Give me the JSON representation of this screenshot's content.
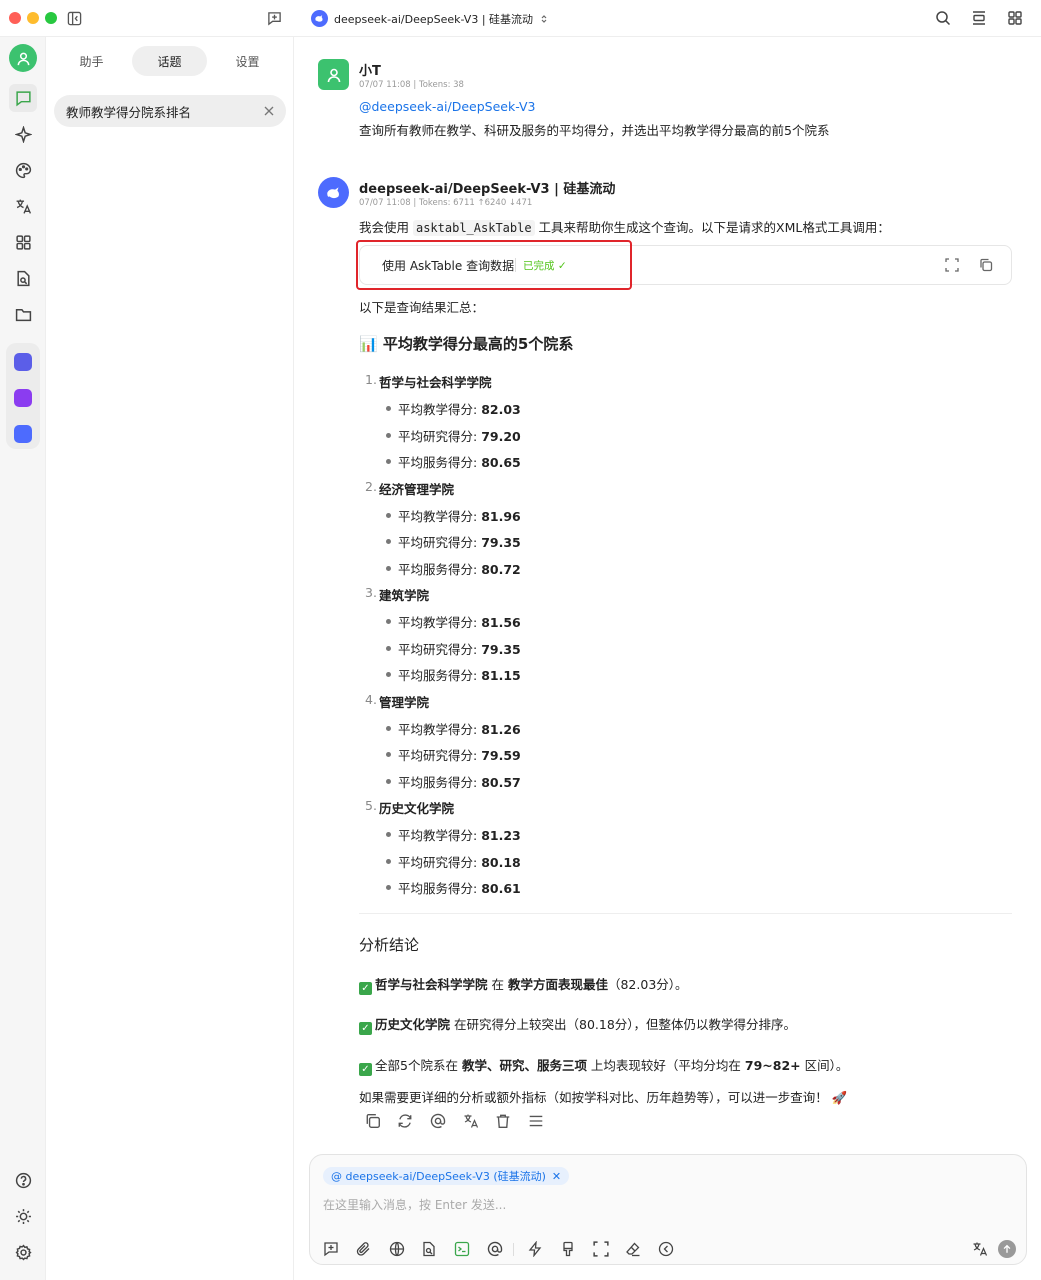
{
  "window": {
    "model_title": "deepseek-ai/DeepSeek-V3 | 硅基流动"
  },
  "sidebar": {
    "tabs": [
      "助手",
      "话题",
      "设置"
    ],
    "active_tab": "话题",
    "topic": "教师教学得分院系排名"
  },
  "messages": {
    "user": {
      "name": "小T",
      "meta": "07/07 11:08  |  Tokens: 38",
      "mention": "@deepseek-ai/DeepSeek-V3",
      "text": "查询所有教师在教学、科研及服务的平均得分，并选出平均教学得分最高的前5个院系"
    },
    "assistant": {
      "name": "deepseek-ai/DeepSeek-V3 | 硅基流动",
      "meta": "07/07 11:08  |  Tokens: 6711 ↑6240 ↓471",
      "intro_before": "我会使用 ",
      "intro_code": "asktabl_AskTable",
      "intro_after": " 工具来帮助你生成这个查询。以下是请求的XML格式工具调用：",
      "tool_label": "使用 AskTable 查询数据",
      "tool_status": "已完成 ✓",
      "summary_intro": "以下是查询结果汇总：",
      "heading": "📊 平均教学得分最高的5个院系",
      "label_teaching": "平均教学得分: ",
      "label_research": "平均研究得分: ",
      "label_service": "平均服务得分: ",
      "departments": [
        {
          "num": "1.",
          "name": "哲学与社会科学学院",
          "teaching": "82.03",
          "research": "79.20",
          "service": "80.65"
        },
        {
          "num": "2.",
          "name": "经济管理学院",
          "teaching": "81.96",
          "research": "79.35",
          "service": "80.72"
        },
        {
          "num": "3.",
          "name": "建筑学院",
          "teaching": "81.56",
          "research": "79.35",
          "service": "81.15"
        },
        {
          "num": "4.",
          "name": "管理学院",
          "teaching": "81.26",
          "research": "79.59",
          "service": "80.57"
        },
        {
          "num": "5.",
          "name": "历史文化学院",
          "teaching": "81.23",
          "research": "80.18",
          "service": "80.61"
        }
      ],
      "conclusion_title": "分析结论",
      "conclusions": [
        {
          "b1": "哲学与社会科学学院",
          "t1": " 在 ",
          "b2": "教学方面表现最佳",
          "t2": "（82.03分）。",
          "b3": "",
          "t3": ""
        },
        {
          "b1": "历史文化学院",
          "t1": " 在研究得分上较突出（80.18分），但整体仍以教学得分排序。",
          "b2": "",
          "t2": "",
          "b3": "",
          "t3": ""
        },
        {
          "b1": "",
          "t1": "全部5个院系在 ",
          "b2": "教学、研究、服务三项",
          "t2": " 上均表现较好（平均分均在 ",
          "b3": "79~82+",
          "t3": " 区间）。"
        }
      ],
      "closing": "如果需要更详细的分析或额外指标（如按学科对比、历年趋势等），可以进一步查询！ 🚀"
    }
  },
  "composer": {
    "chip": "@ deepseek-ai/DeepSeek-V3 (硅基流动)",
    "placeholder": "在这里输入消息，按 Enter 发送..."
  },
  "colors": {
    "accent": "#1a73e8",
    "user_avatar": "#3cc26f",
    "assistant_avatar": "#4d6bfe",
    "highlight_box": "#e0252b",
    "check_green": "#3aa64b"
  }
}
